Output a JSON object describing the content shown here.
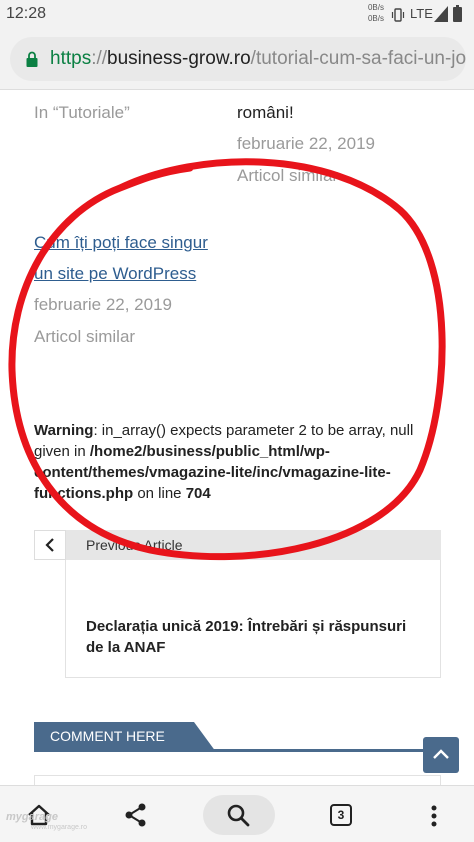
{
  "status_bar": {
    "time": "12:28",
    "net_speed_up": "0B/s",
    "net_speed_down": "0B/s",
    "network": "LTE"
  },
  "browser": {
    "url_scheme": "https",
    "url_sep": "://",
    "url_host": "business-grow.ro",
    "url_path": "/tutorial-cum-sa-faci-un-jo",
    "tab_count": "3"
  },
  "related": {
    "left_top_category": "In “Tutoriale”",
    "right_top_title_tail": "români!",
    "right_top_date": "februarie 22, 2019",
    "right_top_label": "Articol similar",
    "left_post_title_line1": "Cum îți poți face singur",
    "left_post_title_line2": "un site pe WordPress",
    "left_post_date": "februarie 22, 2019",
    "left_post_label": "Articol similar"
  },
  "warning": {
    "label": "Warning",
    "text1": ": in_array() expects parameter 2 to be array, null given in ",
    "path": "/home2/business/public_html/wp-content/themes/vmagazine-lite/inc/vmagazine-lite-functions.php",
    "text2": " on line ",
    "line": "704"
  },
  "prev_article": {
    "nav_label": "Previous Article",
    "title": "Declarația unică 2019: Întrebări și răspunsuri de la ANAF"
  },
  "comments": {
    "header": "COMMENT HERE"
  },
  "watermark": {
    "brand": "mygarage",
    "url": "www.mygarage.ro"
  },
  "colors": {
    "accent": "#4a6a8c",
    "link": "#2e5d8f",
    "annotation": "#e8141b",
    "secure": "#0b8043"
  }
}
